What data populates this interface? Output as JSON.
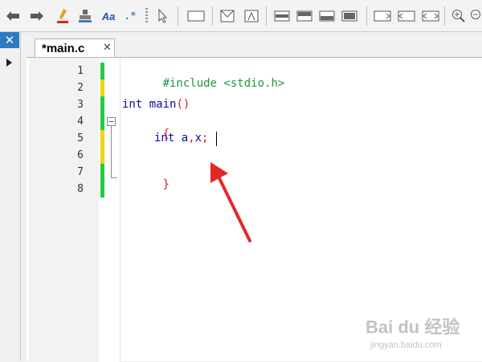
{
  "toolbar": {
    "icons": [
      "back-arrow-icon",
      "forward-arrow-icon",
      "highlight-pen-icon",
      "stamp-icon",
      "font-icon",
      "regex-icon",
      "select-pointer-icon",
      "rectangle-icon",
      "image-icon",
      "image-frame-icon",
      "panel-top-icon",
      "panel-middle-icon",
      "panel-bottom-icon",
      "panel-full-icon",
      "split-left-icon",
      "split-right-icon",
      "split-both-icon",
      "zoom-in-icon",
      "zoom-out-icon"
    ],
    "font_label": "Aa",
    "regex_label": ".*"
  },
  "left_panel": {
    "close_label": "✕"
  },
  "tabs": [
    {
      "label": "*main.c",
      "close_label": "✕"
    }
  ],
  "editor": {
    "line_numbers": [
      "1",
      "2",
      "3",
      "4",
      "5",
      "6",
      "7",
      "8"
    ],
    "code": {
      "l1": "#include <stdio.h>",
      "l3_kw": "int",
      "l3_rest": " main",
      "l3_paren": "()",
      "l4": "{",
      "l5_kw": "int",
      "l5_a": "a",
      "l5_c1": ",",
      "l5_x": "x",
      "l5_semi": ";",
      "l7": "}"
    },
    "change_markers": [
      "green",
      "yellow",
      "green",
      "green",
      "yellow",
      "yellow",
      "green",
      "green"
    ],
    "colors": {
      "green": "#22cc44",
      "yellow": "#f2d40e"
    }
  },
  "watermark": {
    "main": "Bai du 经验",
    "sub": "jingyan.baidu.com"
  }
}
